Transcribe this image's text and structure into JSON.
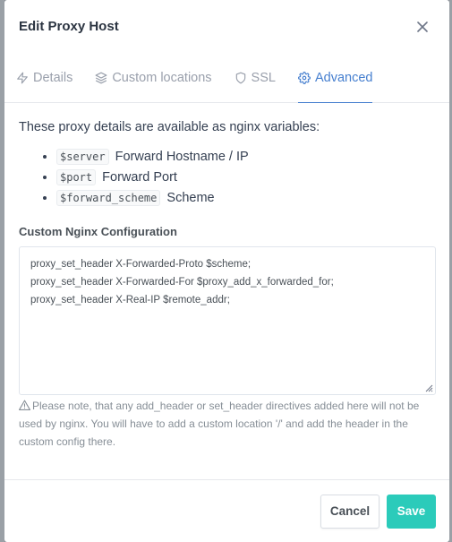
{
  "modal": {
    "title": "Edit Proxy Host"
  },
  "tabs": [
    {
      "label": "Details",
      "icon": "bolt-icon"
    },
    {
      "label": "Custom locations",
      "icon": "layers-icon"
    },
    {
      "label": "SSL",
      "icon": "shield-icon"
    },
    {
      "label": "Advanced",
      "icon": "gear-icon",
      "active": true
    }
  ],
  "advanced": {
    "intro": "These proxy details are available as nginx variables:",
    "variables": [
      {
        "code": "$server",
        "desc": "Forward Hostname / IP"
      },
      {
        "code": "$port",
        "desc": "Forward Port"
      },
      {
        "code": "$forward_scheme",
        "desc": "Scheme"
      }
    ],
    "config_label": "Custom Nginx Configuration",
    "config_lines": [
      "proxy_set_header X-Forwarded-Proto $scheme;",
      "proxy_set_header X-Forwarded-For $proxy_add_x_forwarded_for;",
      "proxy_set_header X-Real-IP $remote_addr;"
    ],
    "note": "Please note, that any add_header or set_header directives added here will not be used by nginx. You will have to add a custom location '/' and add the header in the custom config there."
  },
  "footer": {
    "cancel_label": "Cancel",
    "save_label": "Save"
  },
  "colors": {
    "accent": "#467fcf",
    "save": "#2bcbba"
  }
}
